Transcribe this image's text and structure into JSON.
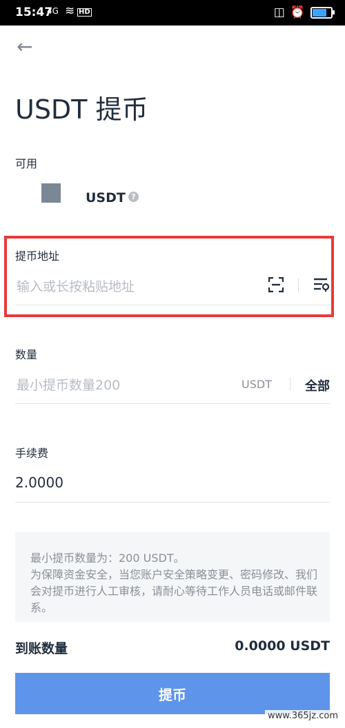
{
  "status_bar": {
    "time": "15:47",
    "signal": "4G",
    "network_badge": "HD"
  },
  "page": {
    "title": "USDT 提币"
  },
  "available": {
    "label": "可用",
    "coin": "USDT",
    "help": "?"
  },
  "address": {
    "label": "提币地址",
    "placeholder": "输入或长按粘贴地址"
  },
  "amount": {
    "label": "数量",
    "placeholder": "最小提币数量200",
    "unit": "USDT",
    "all_label": "全部"
  },
  "fee": {
    "label": "手续费",
    "value": "2.0000"
  },
  "notice": {
    "line1": "最小提币数量为：200 USDT。",
    "line2": "为保障资金安全，当您账户安全策略变更、密码修改、我们会对提币进行人工审核，请耐心等待工作人员电话或邮件联系。"
  },
  "receive": {
    "label": "到账数量",
    "value": "0.0000 USDT"
  },
  "submit": {
    "label": "提币"
  },
  "watermark": "www.365jz.com",
  "colors": {
    "primary": "#5e95ea",
    "highlight_border": "#e83a3a",
    "text": "#1f2d3d",
    "muted": "#8a9098"
  }
}
